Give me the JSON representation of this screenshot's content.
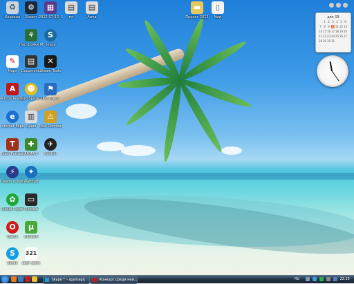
{
  "desktop_icons": [
    {
      "label": "Корзина",
      "icon": "recycle-bin-icon"
    },
    {
      "label": "Steam",
      "icon": "steam-icon"
    },
    {
      "label": "2012-07-13_1",
      "icon": "image-folder-icon"
    },
    {
      "label": "мп",
      "icon": "file-icon"
    },
    {
      "label": "Arma",
      "icon": "file-icon"
    },
    {
      "label": "Настройки Маршрутиз.",
      "icon": "router-settings-icon"
    },
    {
      "label": "Skype",
      "icon": "skype-icon"
    },
    {
      "label": "Documents",
      "icon": "document-icon"
    },
    {
      "label": "Steam Tools",
      "icon": "tools-icon"
    },
    {
      "label": "Maps",
      "icon": "maps-icon"
    },
    {
      "label": "Adobe Reader X",
      "icon": "pdf-icon"
    },
    {
      "label": "TeamSpeak 3",
      "icon": "teamspeak-icon"
    },
    {
      "label": "Far Cry 3",
      "icon": "game-icon"
    },
    {
      "label": "Internet Explorer",
      "icon": "ie-icon"
    },
    {
      "label": "Opera",
      "icon": "opera-icon"
    },
    {
      "label": "Total Commander",
      "icon": "commander-icon"
    },
    {
      "label": "Team Fortress",
      "icon": "tf2-icon"
    },
    {
      "label": "ARMA 2",
      "icon": "arma-icon"
    },
    {
      "label": "Control",
      "icon": "control-icon"
    },
    {
      "label": "Daemon Tools Lite",
      "icon": "daemon-icon"
    },
    {
      "label": "Warcraft",
      "icon": "warcraft-icon"
    },
    {
      "label": "Mumble",
      "icon": "mumble-icon"
    },
    {
      "label": "Media Player",
      "icon": "media-icon"
    },
    {
      "label": "Opera",
      "icon": "opera-icon"
    },
    {
      "label": "uTorrent",
      "icon": "utorrent-icon"
    },
    {
      "label": "Skype",
      "icon": "skype-icon"
    },
    {
      "label": "вирт диск",
      "icon": "calendar-icon"
    }
  ],
  "top_files": [
    {
      "label": "Проект 2012",
      "icon": "folder-icon"
    },
    {
      "label": "New",
      "icon": "document-icon"
    }
  ],
  "calendar": {
    "month": "дек 09",
    "days": [
      "1",
      "2",
      "3",
      "4",
      "5",
      "6",
      "7",
      "8",
      "9",
      "10",
      "11",
      "12",
      "13",
      "14",
      "15",
      "16",
      "17",
      "18",
      "19",
      "20",
      "21",
      "22",
      "23",
      "24",
      "25",
      "26",
      "27",
      "28",
      "29",
      "30",
      "31"
    ],
    "today": "10"
  },
  "taskbar": {
    "tasks": [
      {
        "label": "Skype™ - spymagic",
        "icon": "skype-icon"
      },
      {
        "label": "Конкурс среди ней...",
        "icon": "opera-icon"
      }
    ],
    "language": "RU",
    "time": "22:25"
  },
  "colors": {
    "taskbar": "#223447",
    "sky": "#1f7fd8",
    "sea": "#4fc6e0",
    "sand": "#eef2e6",
    "today_highlight": "#e06020"
  }
}
